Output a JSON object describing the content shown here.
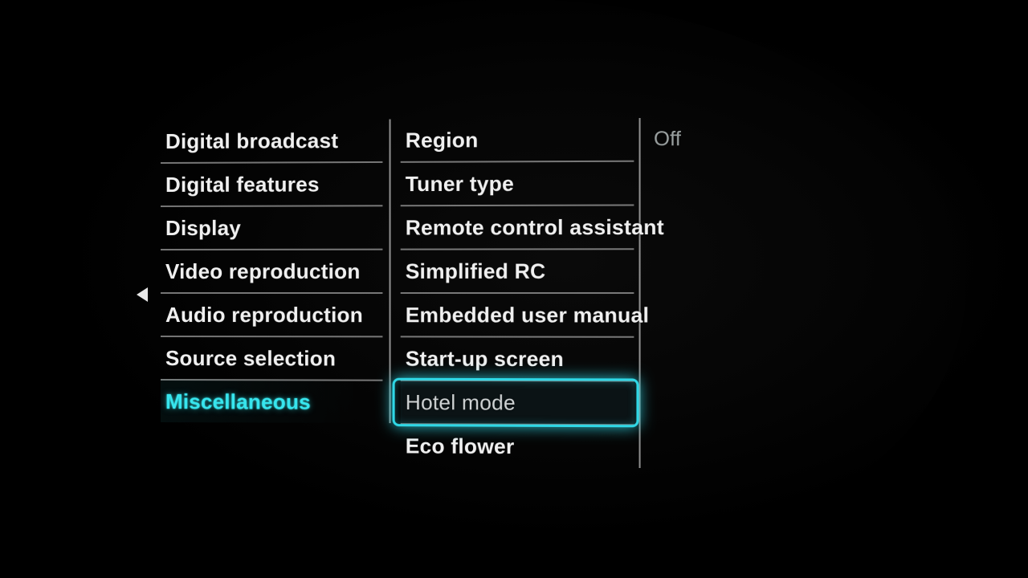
{
  "column1": {
    "items": [
      {
        "label": "Digital broadcast"
      },
      {
        "label": "Digital features"
      },
      {
        "label": "Display"
      },
      {
        "label": "Video reproduction"
      },
      {
        "label": "Audio reproduction"
      },
      {
        "label": "Source selection"
      },
      {
        "label": "Miscellaneous",
        "active": true
      }
    ]
  },
  "column2": {
    "items": [
      {
        "label": "Region"
      },
      {
        "label": "Tuner type"
      },
      {
        "label": "Remote control assistant"
      },
      {
        "label": "Simplified RC"
      },
      {
        "label": "Embedded user manual"
      },
      {
        "label": "Start-up screen"
      },
      {
        "label": "Hotel mode",
        "highlighted": true
      },
      {
        "label": "Eco flower"
      }
    ]
  },
  "column3": {
    "value": "Off"
  }
}
